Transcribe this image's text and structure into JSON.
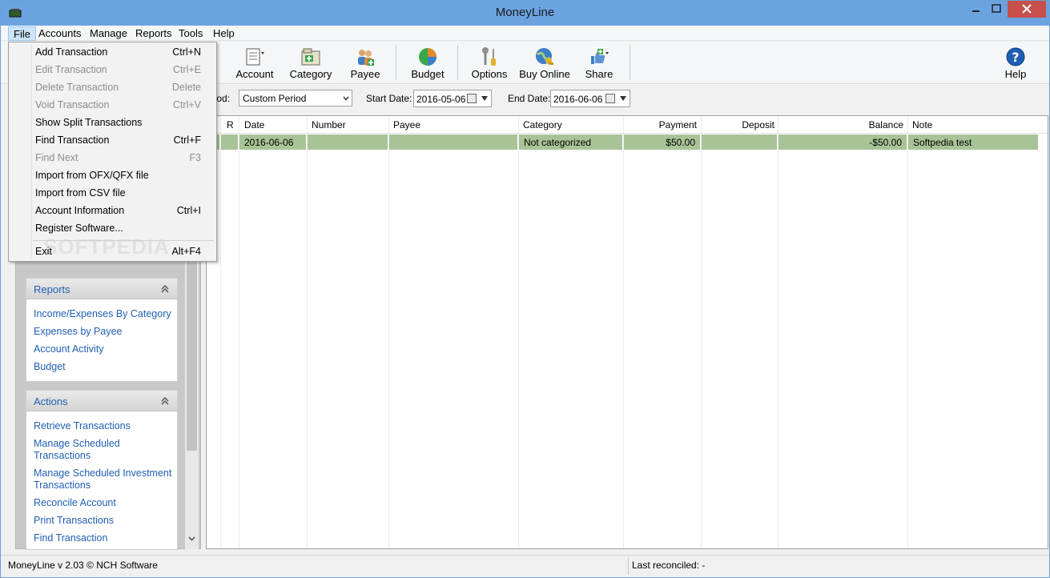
{
  "window": {
    "title": "MoneyLine"
  },
  "menubar": {
    "items": [
      "File",
      "Accounts",
      "Manage",
      "Reports",
      "Tools",
      "Help"
    ]
  },
  "toolbar": {
    "buttons": [
      {
        "label": "Account",
        "icon": "account-icon"
      },
      {
        "label": "Category",
        "icon": "category-icon"
      },
      {
        "label": "Payee",
        "icon": "payee-icon"
      },
      {
        "label": "Budget",
        "icon": "budget-pie-icon"
      },
      {
        "label": "Options",
        "icon": "options-tools-icon"
      },
      {
        "label": "Buy Online",
        "icon": "buy-online-globe-icon"
      },
      {
        "label": "Share",
        "icon": "share-thumbs-up-icon"
      },
      {
        "label": "Help",
        "icon": "help-icon"
      }
    ]
  },
  "filter": {
    "period_label": "eriod:",
    "period_value": "Custom Period",
    "start_label": "Start Date:",
    "start_value": "2016-05-06",
    "end_label": "End Date:",
    "end_value": "2016-06-06"
  },
  "grid": {
    "columns": [
      "R",
      "Date",
      "Number",
      "Payee",
      "Category",
      "Payment",
      "Deposit",
      "Balance",
      "Note"
    ],
    "rows": [
      {
        "r": "",
        "date": "2016-06-06",
        "number": "",
        "payee": "",
        "category": "Not categorized",
        "payment": "$50.00",
        "deposit": "",
        "balance": "-$50.00",
        "note": "Softpedia test"
      }
    ]
  },
  "sidebar": {
    "reports": {
      "title": "Reports",
      "links": [
        "Income/Expenses By Category",
        "Expenses by Payee",
        "Account Activity",
        "Budget"
      ]
    },
    "actions": {
      "title": "Actions",
      "links": [
        "Retrieve Transactions",
        "Manage Scheduled Transactions",
        "Manage Scheduled Investment Transactions",
        "Reconcile Account",
        "Print Transactions",
        "Find Transaction"
      ]
    }
  },
  "file_menu": {
    "items": [
      {
        "label": "Add Transaction",
        "shortcut": "Ctrl+N",
        "enabled": true
      },
      {
        "label": "Edit Transaction",
        "shortcut": "Ctrl+E",
        "enabled": false
      },
      {
        "label": "Delete Transaction",
        "shortcut": "Delete",
        "enabled": false
      },
      {
        "label": "Void Transaction",
        "shortcut": "Ctrl+V",
        "enabled": false
      },
      {
        "label": "Show Split Transactions",
        "shortcut": "",
        "enabled": true
      },
      {
        "label": "Find Transaction",
        "shortcut": "Ctrl+F",
        "enabled": true
      },
      {
        "label": "Find Next",
        "shortcut": "F3",
        "enabled": false
      },
      {
        "label": "Import from OFX/QFX file",
        "shortcut": "",
        "enabled": true
      },
      {
        "label": "Import from CSV file",
        "shortcut": "",
        "enabled": true
      },
      {
        "label": "Account Information",
        "shortcut": "Ctrl+I",
        "enabled": true
      },
      {
        "label": "Register Software...",
        "shortcut": "",
        "enabled": true
      },
      {
        "label": "Exit",
        "shortcut": "Alt+F4",
        "enabled": true
      }
    ],
    "watermark": "SOFTPEDIA"
  },
  "statusbar": {
    "version": "MoneyLine v 2.03 © NCH Software",
    "reconciled": "Last reconciled: -"
  }
}
